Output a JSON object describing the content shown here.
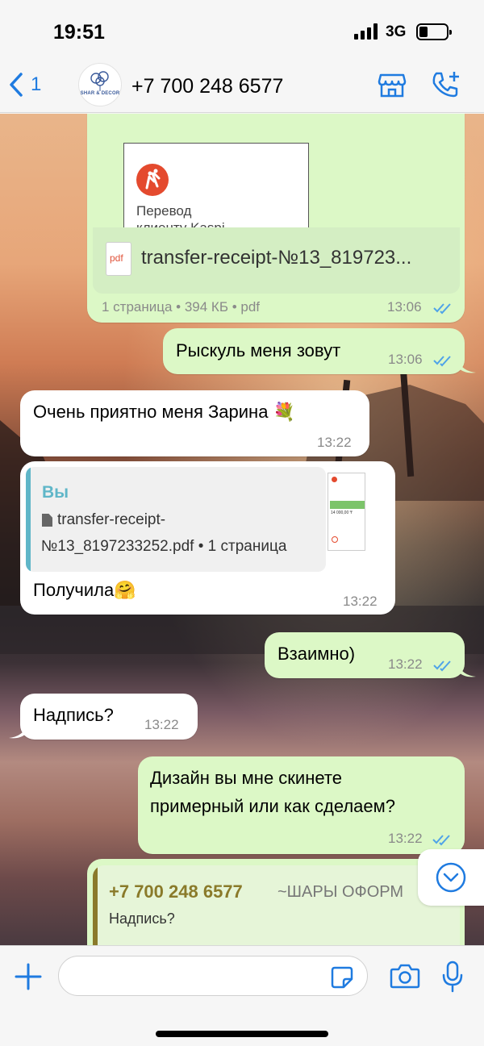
{
  "status": {
    "time": "19:51",
    "network": "3G"
  },
  "header": {
    "back_count": "1",
    "contact": "+7 700 248 6577",
    "avatar_text": "SHAR & DECOR"
  },
  "messages": {
    "pdf": {
      "thumb_title_line1": "Перевод",
      "thumb_title_line2": "клиенту Kaspi",
      "file_ext": "pdf",
      "file_name": "transfer-receipt-№13_819723...",
      "meta": "1 страница • 394 КБ • pdf",
      "time": "13:06"
    },
    "m1": {
      "text": "Рыскуль меня зовут",
      "time": "13:06"
    },
    "m2": {
      "text": "Очень приятно меня Зарина 💐",
      "time": "13:22"
    },
    "m3": {
      "quote_author": "Вы",
      "quote_file_line1": "transfer-receipt-",
      "quote_file_line2": "№13_8197233252.pdf • 1 страница",
      "thumb_amount": "14 000,00 ₸",
      "text": "Получила🤗",
      "time": "13:22"
    },
    "m4": {
      "text": "Взаимно)",
      "time": "13:22"
    },
    "m5": {
      "text": "Надпись?",
      "time": "13:22"
    },
    "m6": {
      "line1": "Дизайн вы мне скинете",
      "line2": "примерный или как сделаем?",
      "time": "13:22"
    },
    "reply": {
      "author": "+7 700 248 6577",
      "author_name": "~ШАРЫ ОФОРМ",
      "text": "Надпись?"
    }
  },
  "colors": {
    "accent": "#1f7be0",
    "outgoing": "#dcf8c6",
    "incoming": "#ffffff",
    "tick": "#4fa3e8"
  }
}
